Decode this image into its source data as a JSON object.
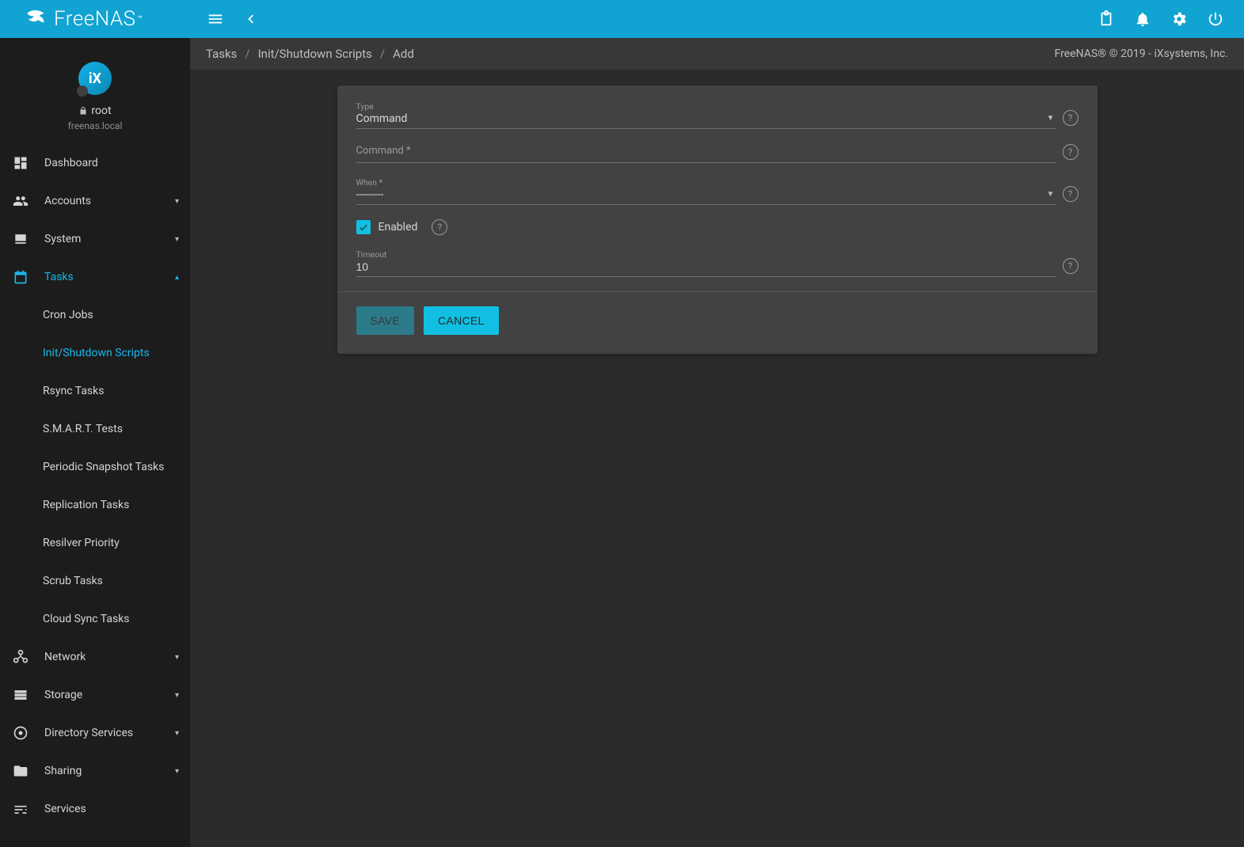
{
  "brand": "FreeNAS",
  "sidebar": {
    "user": "root",
    "host": "freenas.local",
    "items": [
      {
        "label": "Dashboard",
        "icon": "dashboard",
        "caret": ""
      },
      {
        "label": "Accounts",
        "icon": "accounts",
        "caret": "▾"
      },
      {
        "label": "System",
        "icon": "system",
        "caret": "▾"
      },
      {
        "label": "Tasks",
        "icon": "tasks",
        "caret": "▴",
        "active": true
      },
      {
        "label": "Network",
        "icon": "network",
        "caret": "▾"
      },
      {
        "label": "Storage",
        "icon": "storage",
        "caret": "▾"
      },
      {
        "label": "Directory Services",
        "icon": "dirsvc",
        "caret": "▾"
      },
      {
        "label": "Sharing",
        "icon": "sharing",
        "caret": "▾"
      },
      {
        "label": "Services",
        "icon": "services",
        "caret": ""
      }
    ],
    "tasks_sub": [
      {
        "label": "Cron Jobs"
      },
      {
        "label": "Init/Shutdown Scripts",
        "active": true
      },
      {
        "label": "Rsync Tasks"
      },
      {
        "label": "S.M.A.R.T. Tests"
      },
      {
        "label": "Periodic Snapshot Tasks"
      },
      {
        "label": "Replication Tasks"
      },
      {
        "label": "Resilver Priority"
      },
      {
        "label": "Scrub Tasks"
      },
      {
        "label": "Cloud Sync Tasks"
      }
    ]
  },
  "breadcrumb": {
    "a": "Tasks",
    "b": "Init/Shutdown Scripts",
    "c": "Add"
  },
  "copyright": "FreeNAS® © 2019 - iXsystems, Inc.",
  "form": {
    "type_label": "Type",
    "type_value": "Command",
    "command_label": "Command *",
    "command_value": "",
    "when_label": "When *",
    "when_value": "---------",
    "enabled_label": "Enabled",
    "enabled_checked": true,
    "timeout_label": "Timeout",
    "timeout_value": "10",
    "save": "Save",
    "cancel": "Cancel"
  }
}
